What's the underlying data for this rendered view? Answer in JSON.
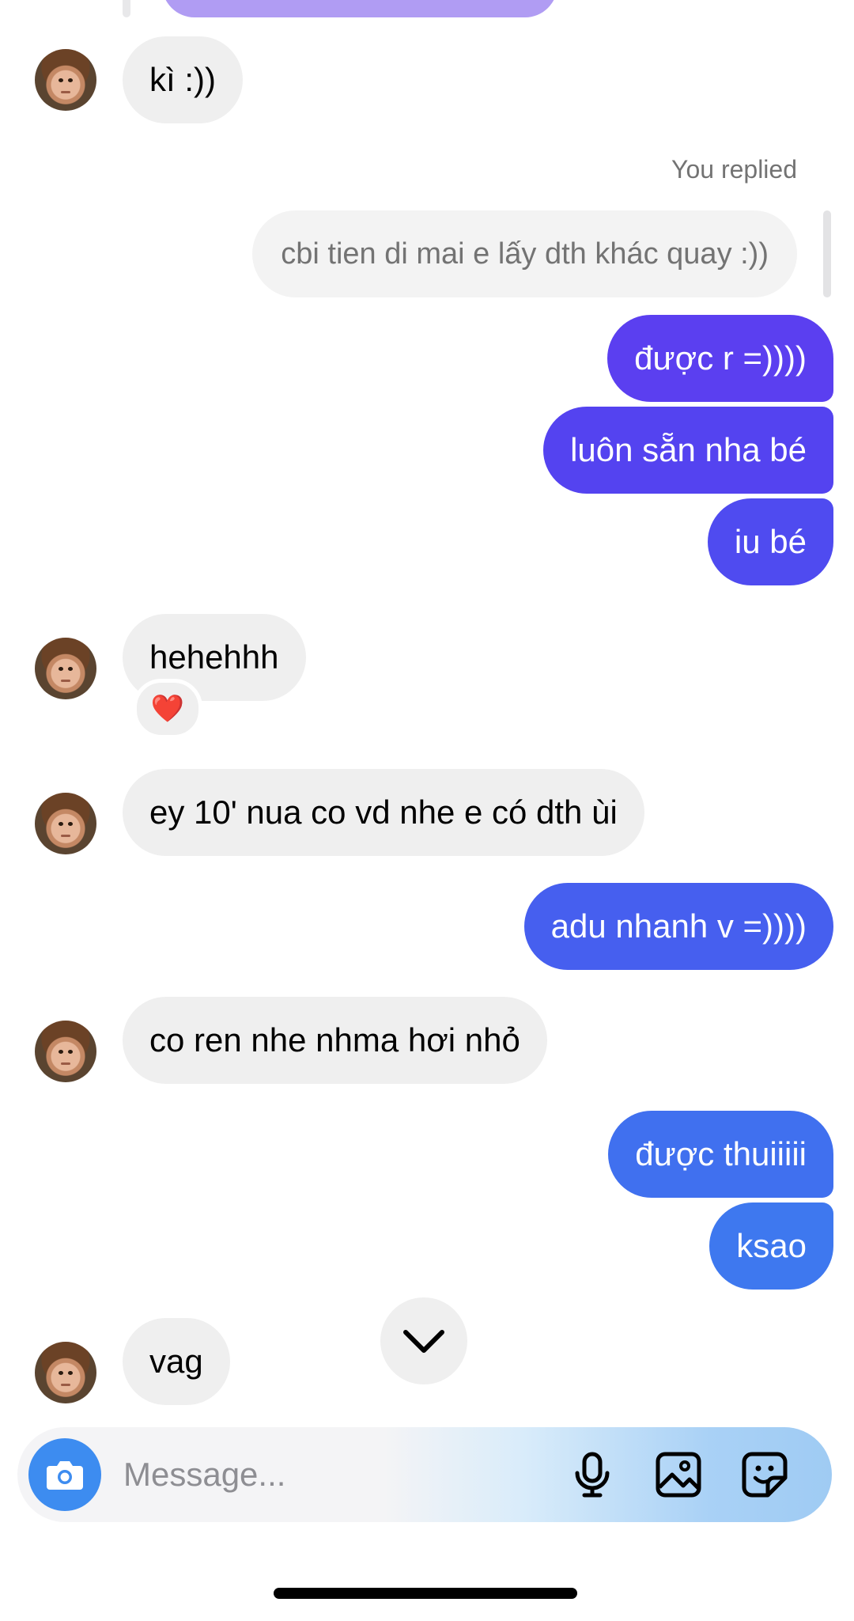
{
  "chat": {
    "messages": [
      {
        "from": "them",
        "text": "kì :))"
      },
      {
        "from": "me",
        "reply_label": "You replied",
        "quoted_text": "cbi tien di mai e lấy dth khác quay :))"
      },
      {
        "from": "me",
        "text": "được r =))))"
      },
      {
        "from": "me",
        "text": "luôn sẵn nha bé"
      },
      {
        "from": "me",
        "text": "iu bé"
      },
      {
        "from": "them",
        "text": "hehehhh",
        "reaction": "❤️"
      },
      {
        "from": "them",
        "text": "ey 10' nua co vd nhe e có dth ùi"
      },
      {
        "from": "me",
        "text": "adu nhanh v =))))"
      },
      {
        "from": "them",
        "text": "co ren nhe nhma hơi nhỏ"
      },
      {
        "from": "me",
        "text": "được thuiiiii"
      },
      {
        "from": "me",
        "text": "ksao"
      },
      {
        "from": "them",
        "text": "vag"
      }
    ]
  },
  "composer": {
    "placeholder": "Message...",
    "icons": [
      "camera-icon",
      "microphone-icon",
      "gallery-icon",
      "sticker-icon"
    ]
  },
  "colors": {
    "outgoing_top": "#5b3ff0",
    "outgoing_mid": "#4f57f0",
    "outgoing_bottom": "#3e78ef",
    "incoming": "#efefef",
    "accent": "#3d8cf0"
  }
}
